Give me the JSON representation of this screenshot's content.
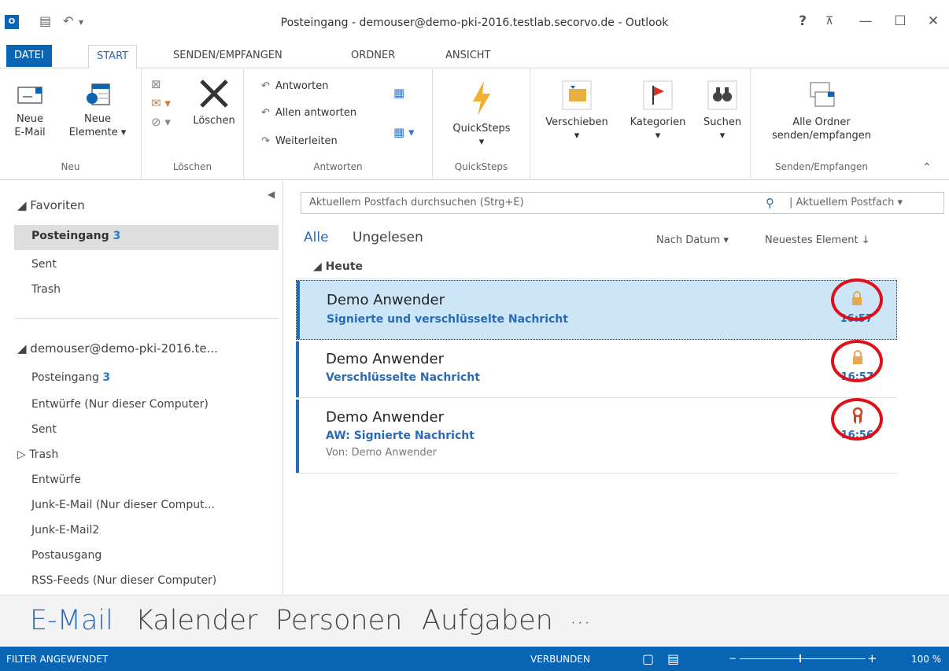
{
  "window": {
    "title": "Posteingang - demouser@demo-pki-2016.testlab.secorvo.de - Outlook",
    "help": "?",
    "restore_ribbon": "⊼",
    "minimize": "—",
    "maximize": "☐",
    "close": "✕"
  },
  "tabs": {
    "file": "DATEI",
    "start": "START",
    "send": "SENDEN/EMPFANGEN",
    "folder": "ORDNER",
    "view": "ANSICHT"
  },
  "ribbon": {
    "new_mail": [
      "Neue",
      "E-Mail"
    ],
    "new_items": [
      "Neue",
      "Elemente ▾"
    ],
    "group_new": "Neu",
    "delete": "Löschen",
    "group_delete": "Löschen",
    "reply": "Antworten",
    "reply_all": "Allen antworten",
    "forward": "Weiterleiten",
    "group_respond": "Antworten",
    "quicksteps": "QuickSteps",
    "group_quicksteps": "QuickSteps",
    "move": "Verschieben",
    "categorize": "Kategorien",
    "search": "Suchen",
    "send_all": [
      "Alle Ordner",
      "senden/empfangen"
    ],
    "group_send": "Senden/Empfangen"
  },
  "nav": {
    "favorites": "◢ Favoriten",
    "fav_items": [
      {
        "label": "Posteingang",
        "count": "3"
      },
      {
        "label": "Sent"
      },
      {
        "label": "Trash"
      }
    ],
    "account": "◢ demouser@demo-pki-2016.te...",
    "account_items": [
      {
        "label": "Posteingang",
        "count": "3"
      },
      {
        "label": "Entwürfe (Nur dieser Computer)"
      },
      {
        "label": "Sent"
      },
      {
        "label": "▷ Trash"
      },
      {
        "label": "Entwürfe"
      },
      {
        "label": "Junk-E-Mail (Nur dieser Comput..."
      },
      {
        "label": "Junk-E-Mail2"
      },
      {
        "label": "Postausgang"
      },
      {
        "label": "RSS-Feeds (Nur dieser Computer)"
      }
    ]
  },
  "search": {
    "placeholder": "Aktuellem Postfach durchsuchen (Strg+E)",
    "scope": "| Aktuellem Postfach ▾"
  },
  "filters": {
    "all": "Alle",
    "unread": "Ungelesen",
    "sort_by": "Nach Datum ▾",
    "sort_order": "Neuestes Element ↓"
  },
  "group_today": "◢ Heute",
  "messages": [
    {
      "sender": "Demo Anwender",
      "subject": "Signierte und verschlüsselte Nachricht",
      "time": "16:57",
      "icon": "lock-icon"
    },
    {
      "sender": "Demo Anwender",
      "subject": "Verschlüsselte Nachricht",
      "time": "16:57",
      "icon": "lock-icon"
    },
    {
      "sender": "Demo Anwender",
      "subject": "AW: Signierte Nachricht",
      "from": "Von: Demo Anwender",
      "time": "16:56",
      "icon": "certificate-ribbon-icon"
    }
  ],
  "modes": {
    "mail": "E-Mail",
    "calendar": "Kalender",
    "people": "Personen",
    "tasks": "Aufgaben",
    "more": "···"
  },
  "status": {
    "filter": "FILTER ANGEWENDET",
    "connected": "VERBUNDEN",
    "zoom": "100 %"
  },
  "colors": {
    "accent": "#0a64b4",
    "highlight_ring": "#e0101a",
    "lock": "#e8a850",
    "seal": "#d04020"
  }
}
